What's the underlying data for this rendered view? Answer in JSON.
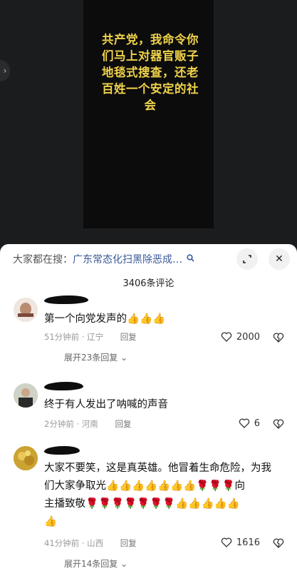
{
  "video": {
    "overlay_text": "共产党，我命令你\n们马上对器官贩子\n地毯式搜查，还老\n百姓一个安定的社\n会",
    "side_handle": "›"
  },
  "comments_panel": {
    "search_prefix": "大家都在搜：",
    "search_query": "广东常态化扫黑除恶成…",
    "search_icon": "search-icon",
    "count_label": "3406条评论",
    "collapse_icon": "collapse-icon",
    "close_icon": "close-icon",
    "close_label": "✕"
  },
  "comments": [
    {
      "text": "第一个向党发声的👍👍👍",
      "time": "51分钟前 · 辽宁",
      "reply": "回复",
      "likes": "2000",
      "expand": "展开23条回复 ⌄"
    },
    {
      "text": "终于有人发出了呐喊的声音",
      "time": "2分钟前 · 河南",
      "reply": "回复",
      "likes": "6"
    },
    {
      "text_line1": "大家不要笑，这是真英雄。他冒着生命危险，为我",
      "text_line2": "们大家争取光👍👍👍👍👍👍👍🌹🌹🌹向",
      "text_line3": "主播致敬🌹🌹🌹🌹🌹🌹🌹👍👍👍👍👍",
      "text_line4": "👍",
      "time": "41分钟前 · 山西",
      "reply": "回复",
      "likes": "1616",
      "expand": "展开14条回复 ⌄"
    }
  ]
}
